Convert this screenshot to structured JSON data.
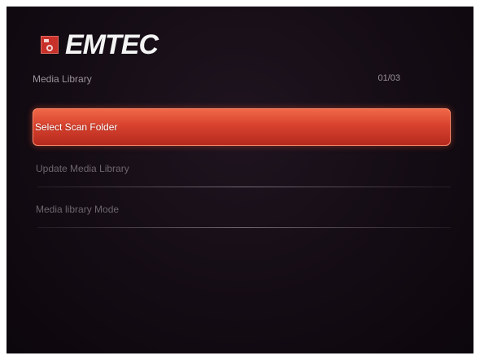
{
  "brand": {
    "name": "EMTEC"
  },
  "header": {
    "title": "Media Library",
    "page_counter": "01/03"
  },
  "menu": {
    "items": [
      {
        "label": "Select Scan Folder",
        "selected": true
      },
      {
        "label": "Update Media Library",
        "selected": false
      },
      {
        "label": "Media library Mode",
        "selected": false
      }
    ]
  },
  "colors": {
    "accent": "#d8422e",
    "background": "#140c14",
    "text_dim": "#6d666d",
    "text_header": "#9a929a",
    "logo_badge": "#c8302a"
  },
  "icons": {
    "logo": "emtec-logo-icon"
  }
}
